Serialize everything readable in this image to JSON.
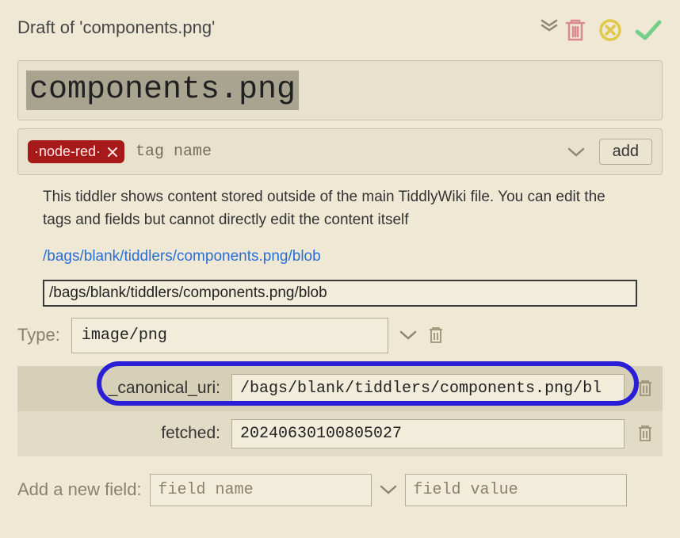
{
  "header": {
    "draft_title": "Draft of 'components.png'"
  },
  "title": "components.png",
  "tags": {
    "items": [
      {
        "label": "·node-red·"
      }
    ],
    "placeholder": "tag name",
    "add_label": "add"
  },
  "body": {
    "description": "This tiddler shows content stored outside of the main TiddlyWiki file. You can edit the tags and fields but cannot directly edit the content itself",
    "link_text": "/bags/blank/tiddlers/components.png/blob",
    "uri_value": "/bags/blank/tiddlers/components.png/blob"
  },
  "type": {
    "label": "Type:",
    "value": "image/png"
  },
  "fields": [
    {
      "name": "_canonical_uri:",
      "value": "/bags/blank/tiddlers/components.png/bl"
    },
    {
      "name": "fetched:",
      "value": "20240630100805027"
    }
  ],
  "newfield": {
    "label": "Add a new field:",
    "name_placeholder": "field name",
    "value_placeholder": "field value"
  },
  "colors": {
    "danger": "#d98a8a",
    "warning": "#e0c94a",
    "success": "#74cf8a",
    "tag_bg": "#a71a1a",
    "highlight": "#2a1ed6"
  }
}
